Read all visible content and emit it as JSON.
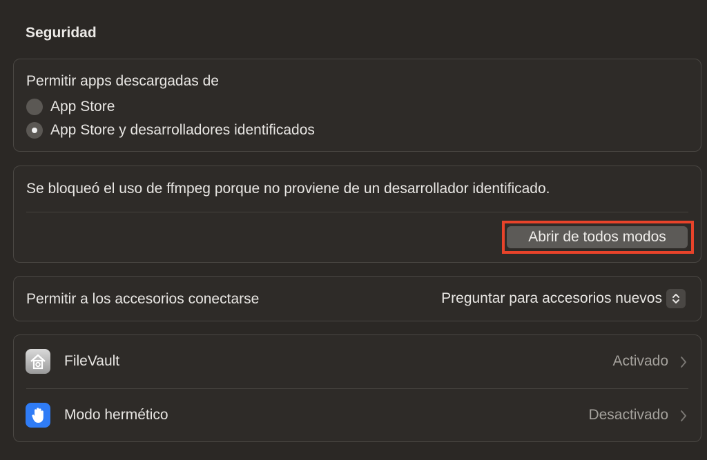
{
  "section": {
    "title": "Seguridad"
  },
  "downloads": {
    "heading": "Permitir apps descargadas de",
    "options": [
      {
        "label": "App Store",
        "selected": false
      },
      {
        "label": "App Store y desarrolladores identificados",
        "selected": true
      }
    ]
  },
  "blocked": {
    "message": "Se bloqueó el uso de ffmpeg porque no proviene de un desarrollador identificado.",
    "open_button": "Abrir de todos modos",
    "highlight_color": "#e8432a"
  },
  "accessories": {
    "label": "Permitir a los accesorios conectarse",
    "selected_option": "Preguntar para accesorios nuevos"
  },
  "features": [
    {
      "name": "FileVault",
      "status": "Activado",
      "icon": "filevault-icon"
    },
    {
      "name": "Modo hermético",
      "status": "Desactivado",
      "icon": "lockdown-hand-icon"
    }
  ]
}
